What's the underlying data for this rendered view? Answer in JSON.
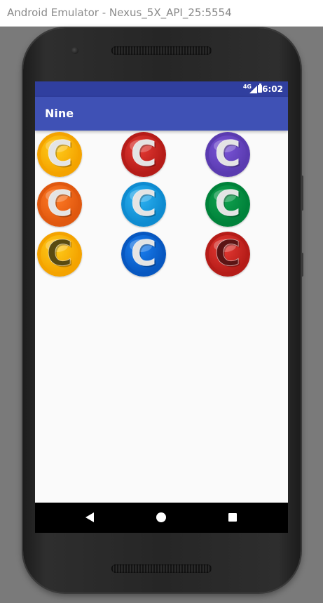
{
  "window": {
    "title": "Android Emulator - Nexus_5X_API_25:5554"
  },
  "status_bar": {
    "network_label": "4G",
    "time": "6:02",
    "color": "#303f9f"
  },
  "app_bar": {
    "title": "Nine",
    "color": "#3f51b5"
  },
  "grid": {
    "columns": 3,
    "coins": [
      {
        "name": "coin-yellow",
        "letter": "C",
        "ring": "#f4a300",
        "face": "#ffcc1a",
        "letter_color": "#e4e4e4"
      },
      {
        "name": "coin-red",
        "letter": "C",
        "ring": "#b51c18",
        "face": "#e53a34",
        "letter_color": "#e4e4e4"
      },
      {
        "name": "coin-purple",
        "letter": "C",
        "ring": "#5a3bb0",
        "face": "#7b55d8",
        "letter_color": "#e4e4e4"
      },
      {
        "name": "coin-orange",
        "letter": "C",
        "ring": "#e0580f",
        "face": "#ff7a24",
        "letter_color": "#e4e4e4"
      },
      {
        "name": "coin-light-blue",
        "letter": "C",
        "ring": "#0e8bd0",
        "face": "#2db2f2",
        "letter_color": "#e4e4e4"
      },
      {
        "name": "coin-green",
        "letter": "C",
        "ring": "#00823a",
        "face": "#11a24f",
        "letter_color": "#e4e4e4"
      },
      {
        "name": "coin-yellow-dark",
        "letter": "C",
        "ring": "#f4a300",
        "face": "#ffcc1a",
        "letter_color": "#5a4a10"
      },
      {
        "name": "coin-blue",
        "letter": "C",
        "ring": "#0757c0",
        "face": "#1a7ff0",
        "letter_color": "#e4e4e4"
      },
      {
        "name": "coin-red-dark",
        "letter": "C",
        "ring": "#b51c18",
        "face": "#e53a34",
        "letter_color": "#5c1414"
      }
    ]
  },
  "nav_bar": {
    "back_icon": "back-triangle-icon",
    "home_icon": "home-circle-icon",
    "recents_icon": "recents-square-icon"
  }
}
